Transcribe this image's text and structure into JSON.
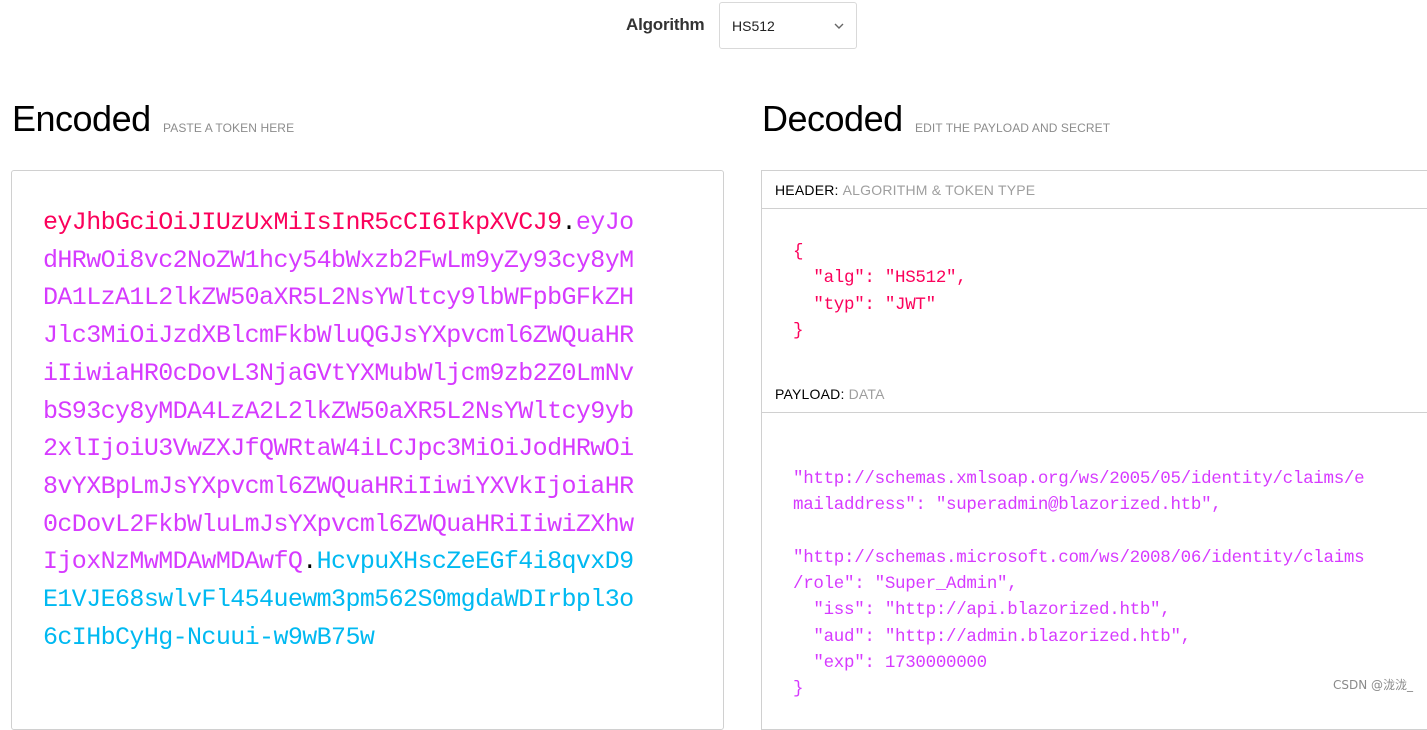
{
  "toolbar": {
    "algorithm_label": "Algorithm",
    "algorithm_value": "HS512",
    "algorithm_chevron_icon": "chevron-down-icon"
  },
  "encoded": {
    "title": "Encoded",
    "subtitle": "PASTE A TOKEN HERE",
    "token": {
      "header": "eyJhbGciOiJIUzUxMiIsInR5cCI6IkpXVCJ9",
      "payload": "eyJodHRwOi8vc2NoZW1hcy54bWxzb2FwLm9yZy93cy8yMDA1LzA1L2lkZW50aXR5L2NsYWltcy9lbWFpbGFkZHJlc3MiOiJzdXBlcmFkbWluQGJsYXpvcml6ZWQuaHRiIiwiaHR0cDovL3NjaGVtYXMubWljcm9zb2Z0LmNvbS93cy8yMDA4LzA2L2lkZW50aXR5L2NsYWltcy9yb2xlIjoiU3VwZXJfQWRtaW4iLCJpc3MiOiJodHRwOi8vYXBpLmJsYXpvcml6ZWQuaHRiIiwiYXVkIjoiaHR0cDovL2FkbWluLmJsYXpvcml6ZWQuaHRiIiwiZXhwIjoxNzMwMDAwMDAwfQ",
      "signature": "HcvpuXHscZeEGf4i8qvxD9E1VJE68swlvFl454uewm3pm562S0mgdaWDIrbpl3o6cIHbCyHg-Ncuui-w9wB75w",
      "separator": "."
    },
    "colors": {
      "header": "#fb015b",
      "payload": "#d63aff",
      "signature": "#00b9f1"
    }
  },
  "decoded": {
    "title": "Decoded",
    "subtitle": "EDIT THE PAYLOAD AND SECRET",
    "header_section": {
      "title": "HEADER:",
      "subtitle": "ALGORITHM & TOKEN TYPE",
      "json": "{\n  \"alg\": \"HS512\",\n  \"typ\": \"JWT\"\n}"
    },
    "payload_section": {
      "title": "PAYLOAD:",
      "subtitle": "DATA",
      "json": "\"http://schemas.xmlsoap.org/ws/2005/05/identity/claims/e\nmailaddress\": \"superadmin@blazorized.htb\",\n\n\"http://schemas.microsoft.com/ws/2008/06/identity/claims\n/role\": \"Super_Admin\",\n  \"iss\": \"http://api.blazorized.htb\",\n  \"aud\": \"http://admin.blazorized.htb\",\n  \"exp\": 1730000000\n}"
    }
  },
  "watermark": "CSDN @泷泷_"
}
